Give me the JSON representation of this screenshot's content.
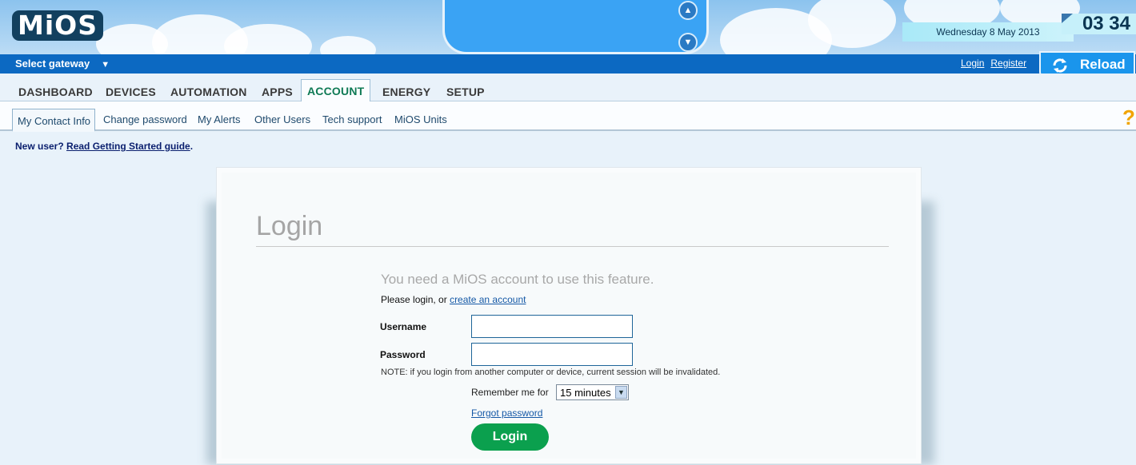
{
  "header": {
    "logo_text": "MiOS",
    "date": "Wednesday 8 May 2013",
    "time": "03 34"
  },
  "topbar": {
    "gateway_label": "Select gateway",
    "login_link": "Login",
    "register_link": "Register",
    "reload_label": "Reload"
  },
  "main_tabs": [
    "DASHBOARD",
    "DEVICES",
    "AUTOMATION",
    "APPS",
    "ACCOUNT",
    "ENERGY",
    "SETUP"
  ],
  "active_main_tab": "ACCOUNT",
  "sub_tabs": [
    "My Contact Info",
    "Change password",
    "My Alerts",
    "Other Users",
    "Tech support",
    "MiOS Units"
  ],
  "active_sub_tab": "My Contact Info",
  "help_icon": "?",
  "new_user": {
    "prefix": "New user?",
    "link": "Read Getting Started guide",
    "suffix": "."
  },
  "login_card": {
    "title": "Login",
    "need_account": "You need a MiOS account to use this feature.",
    "please_prefix": "Please login, or",
    "create_link": "create an account",
    "username_label": "Username",
    "username_value": "",
    "password_label": "Password",
    "password_value": "",
    "note": "NOTE: if you login from another computer or device, current session will be invalidated.",
    "remember_label": "Remember me for",
    "remember_value": "15 minutes",
    "forgot_link": "Forgot password",
    "login_button": "Login"
  },
  "colors": {
    "brand_navy": "#12405f",
    "bar_blue": "#0c69c2",
    "active_tab_green": "#0f7a55",
    "login_green": "#0ba04e",
    "help_orange": "#f1a400"
  }
}
